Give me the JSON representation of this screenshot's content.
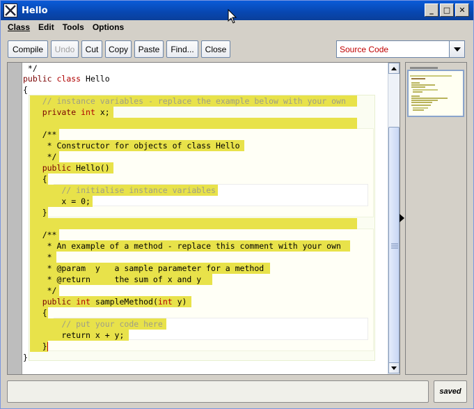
{
  "window": {
    "title": "Hello",
    "minimize_glyph": "_",
    "maximize_glyph": "□",
    "close_glyph": "✕"
  },
  "menu": [
    {
      "label": "Class"
    },
    {
      "label": "Edit"
    },
    {
      "label": "Tools"
    },
    {
      "label": "Options"
    }
  ],
  "toolbar": {
    "compile": "Compile",
    "undo": "Undo",
    "cut": "Cut",
    "copy": "Copy",
    "paste": "Paste",
    "find": "Find...",
    "close": "Close"
  },
  "view_select": {
    "value": "Source Code"
  },
  "code": {
    "l01": " */",
    "l02_kw1": "public",
    "l02_kw2": "class",
    "l02_rest": " Hello",
    "l03": "{",
    "l04": "    // instance variables - replace the example below with your own",
    "l05_kw": "    private",
    "l05_t": "int",
    "l05_rest": " x;",
    "l07": "    /**",
    "l08": "     * Constructor for objects of class Hello",
    "l09": "     */",
    "l10_kw": "    public",
    "l10_rest": " Hello()",
    "l11": "    {",
    "l12": "        // initialise instance variables",
    "l13": "        x = 0;",
    "l14": "    }",
    "l16": "    /**",
    "l17": "     * An example of a method - replace this comment with your own",
    "l18": "     *",
    "l19": "     * @param  y   a sample parameter for a method",
    "l20": "     * @return     the sum of x and y",
    "l21": "     */",
    "l22_kw": "    public",
    "l22_t": "int",
    "l22_mid": " sampleMethod(",
    "l22_t2": "int",
    "l22_end": " y)",
    "l23": "    {",
    "l24": "        // put your code here",
    "l25": "        return x + y;",
    "l26": "    }",
    "l27": "}"
  },
  "status": {
    "message": "",
    "saved": "saved"
  },
  "colors": {
    "highlight": "#e8e24a",
    "keyword": "#7a0000",
    "type": "#b00000",
    "comment": "#9e9e86",
    "view_select_text": "#c00000"
  }
}
